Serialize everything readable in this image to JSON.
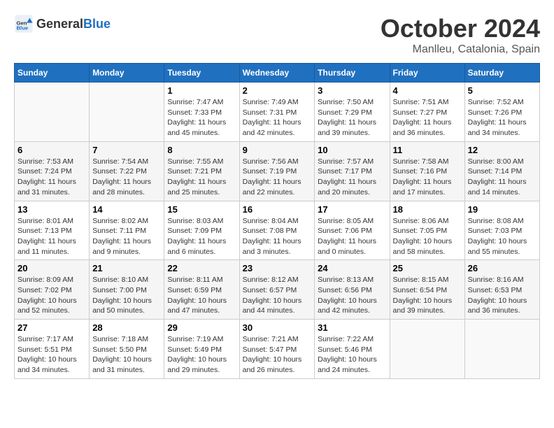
{
  "header": {
    "logo": {
      "text_general": "General",
      "text_blue": "Blue"
    },
    "title": "October 2024",
    "location": "Manlleu, Catalonia, Spain"
  },
  "weekdays": [
    "Sunday",
    "Monday",
    "Tuesday",
    "Wednesday",
    "Thursday",
    "Friday",
    "Saturday"
  ],
  "weeks": [
    [
      null,
      null,
      {
        "day": 1,
        "sunrise": "7:47 AM",
        "sunset": "7:33 PM",
        "daylight": "11 hours and 45 minutes."
      },
      {
        "day": 2,
        "sunrise": "7:49 AM",
        "sunset": "7:31 PM",
        "daylight": "11 hours and 42 minutes."
      },
      {
        "day": 3,
        "sunrise": "7:50 AM",
        "sunset": "7:29 PM",
        "daylight": "11 hours and 39 minutes."
      },
      {
        "day": 4,
        "sunrise": "7:51 AM",
        "sunset": "7:27 PM",
        "daylight": "11 hours and 36 minutes."
      },
      {
        "day": 5,
        "sunrise": "7:52 AM",
        "sunset": "7:26 PM",
        "daylight": "11 hours and 34 minutes."
      }
    ],
    [
      {
        "day": 6,
        "sunrise": "7:53 AM",
        "sunset": "7:24 PM",
        "daylight": "11 hours and 31 minutes."
      },
      {
        "day": 7,
        "sunrise": "7:54 AM",
        "sunset": "7:22 PM",
        "daylight": "11 hours and 28 minutes."
      },
      {
        "day": 8,
        "sunrise": "7:55 AM",
        "sunset": "7:21 PM",
        "daylight": "11 hours and 25 minutes."
      },
      {
        "day": 9,
        "sunrise": "7:56 AM",
        "sunset": "7:19 PM",
        "daylight": "11 hours and 22 minutes."
      },
      {
        "day": 10,
        "sunrise": "7:57 AM",
        "sunset": "7:17 PM",
        "daylight": "11 hours and 20 minutes."
      },
      {
        "day": 11,
        "sunrise": "7:58 AM",
        "sunset": "7:16 PM",
        "daylight": "11 hours and 17 minutes."
      },
      {
        "day": 12,
        "sunrise": "8:00 AM",
        "sunset": "7:14 PM",
        "daylight": "11 hours and 14 minutes."
      }
    ],
    [
      {
        "day": 13,
        "sunrise": "8:01 AM",
        "sunset": "7:13 PM",
        "daylight": "11 hours and 11 minutes."
      },
      {
        "day": 14,
        "sunrise": "8:02 AM",
        "sunset": "7:11 PM",
        "daylight": "11 hours and 9 minutes."
      },
      {
        "day": 15,
        "sunrise": "8:03 AM",
        "sunset": "7:09 PM",
        "daylight": "11 hours and 6 minutes."
      },
      {
        "day": 16,
        "sunrise": "8:04 AM",
        "sunset": "7:08 PM",
        "daylight": "11 hours and 3 minutes."
      },
      {
        "day": 17,
        "sunrise": "8:05 AM",
        "sunset": "7:06 PM",
        "daylight": "11 hours and 0 minutes."
      },
      {
        "day": 18,
        "sunrise": "8:06 AM",
        "sunset": "7:05 PM",
        "daylight": "10 hours and 58 minutes."
      },
      {
        "day": 19,
        "sunrise": "8:08 AM",
        "sunset": "7:03 PM",
        "daylight": "10 hours and 55 minutes."
      }
    ],
    [
      {
        "day": 20,
        "sunrise": "8:09 AM",
        "sunset": "7:02 PM",
        "daylight": "10 hours and 52 minutes."
      },
      {
        "day": 21,
        "sunrise": "8:10 AM",
        "sunset": "7:00 PM",
        "daylight": "10 hours and 50 minutes."
      },
      {
        "day": 22,
        "sunrise": "8:11 AM",
        "sunset": "6:59 PM",
        "daylight": "10 hours and 47 minutes."
      },
      {
        "day": 23,
        "sunrise": "8:12 AM",
        "sunset": "6:57 PM",
        "daylight": "10 hours and 44 minutes."
      },
      {
        "day": 24,
        "sunrise": "8:13 AM",
        "sunset": "6:56 PM",
        "daylight": "10 hours and 42 minutes."
      },
      {
        "day": 25,
        "sunrise": "8:15 AM",
        "sunset": "6:54 PM",
        "daylight": "10 hours and 39 minutes."
      },
      {
        "day": 26,
        "sunrise": "8:16 AM",
        "sunset": "6:53 PM",
        "daylight": "10 hours and 36 minutes."
      }
    ],
    [
      {
        "day": 27,
        "sunrise": "7:17 AM",
        "sunset": "5:51 PM",
        "daylight": "10 hours and 34 minutes."
      },
      {
        "day": 28,
        "sunrise": "7:18 AM",
        "sunset": "5:50 PM",
        "daylight": "10 hours and 31 minutes."
      },
      {
        "day": 29,
        "sunrise": "7:19 AM",
        "sunset": "5:49 PM",
        "daylight": "10 hours and 29 minutes."
      },
      {
        "day": 30,
        "sunrise": "7:21 AM",
        "sunset": "5:47 PM",
        "daylight": "10 hours and 26 minutes."
      },
      {
        "day": 31,
        "sunrise": "7:22 AM",
        "sunset": "5:46 PM",
        "daylight": "10 hours and 24 minutes."
      },
      null,
      null
    ]
  ]
}
